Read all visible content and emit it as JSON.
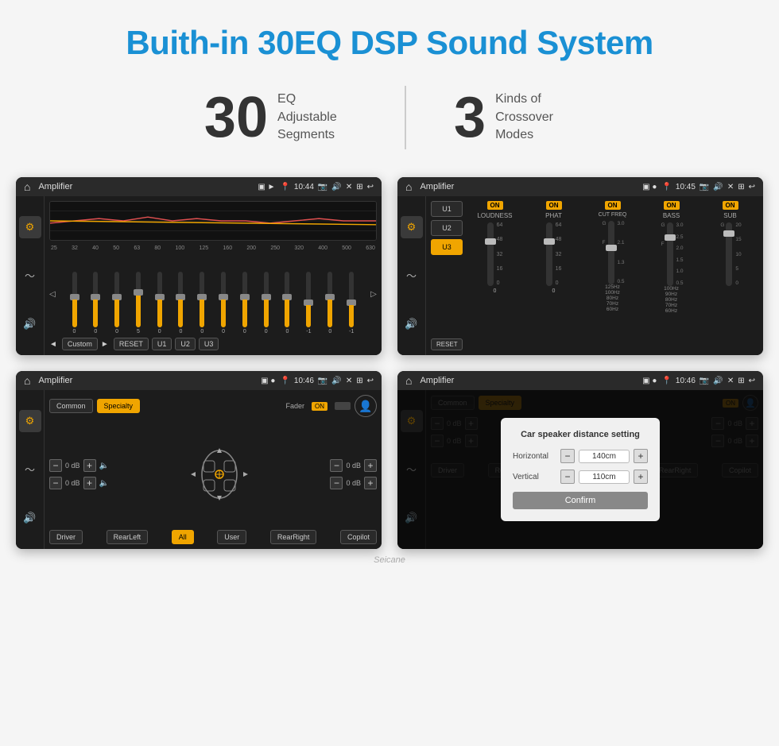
{
  "page": {
    "title": "Buith-in 30EQ DSP Sound System",
    "stats": [
      {
        "number": "30",
        "label": "EQ Adjustable\nSegments"
      },
      {
        "number": "3",
        "label": "Kinds of\nCrossover Modes"
      }
    ]
  },
  "screens": {
    "eq": {
      "status_bar": {
        "title": "Amplifier",
        "time": "10:44"
      },
      "freq_labels": [
        "25",
        "32",
        "40",
        "50",
        "63",
        "80",
        "100",
        "125",
        "160",
        "200",
        "250",
        "320",
        "400",
        "500",
        "630"
      ],
      "sliders": [
        {
          "pos": 55,
          "val": "0"
        },
        {
          "pos": 50,
          "val": "0"
        },
        {
          "pos": 45,
          "val": "0"
        },
        {
          "pos": 52,
          "val": "5"
        },
        {
          "pos": 48,
          "val": "0"
        },
        {
          "pos": 50,
          "val": "0"
        },
        {
          "pos": 50,
          "val": "0"
        },
        {
          "pos": 48,
          "val": "0"
        },
        {
          "pos": 50,
          "val": "0"
        },
        {
          "pos": 50,
          "val": "0"
        },
        {
          "pos": 50,
          "val": "0"
        },
        {
          "pos": 45,
          "val": "0"
        },
        {
          "pos": 42,
          "val": "-1"
        },
        {
          "pos": 50,
          "val": "0"
        },
        {
          "pos": 42,
          "val": "-1"
        }
      ],
      "buttons": {
        "prev": "◄",
        "label": "Custom",
        "play": "►",
        "reset": "RESET",
        "u1": "U1",
        "u2": "U2",
        "u3": "U3"
      }
    },
    "crossover": {
      "status_bar": {
        "title": "Amplifier",
        "time": "10:45"
      },
      "presets": [
        "U1",
        "U2",
        "U3"
      ],
      "active_preset": "U3",
      "channels": [
        {
          "name": "LOUDNESS",
          "on": true
        },
        {
          "name": "PHAT",
          "on": true
        },
        {
          "name": "CUT FREQ",
          "on": true
        },
        {
          "name": "BASS",
          "on": true
        },
        {
          "name": "SUB",
          "on": true
        }
      ],
      "reset_label": "RESET"
    },
    "specialty": {
      "status_bar": {
        "title": "Amplifier",
        "time": "10:46"
      },
      "tabs": [
        "Common",
        "Specialty"
      ],
      "active_tab": "Specialty",
      "fader_label": "Fader",
      "fader_on": "ON",
      "zones": {
        "front_left": "0 dB",
        "front_right": "0 dB",
        "rear_left": "0 dB",
        "rear_right": "0 dB"
      },
      "buttons": [
        "Driver",
        "RearLeft",
        "All",
        "User",
        "RearRight",
        "Copilot"
      ],
      "all_highlight": true
    },
    "distance": {
      "status_bar": {
        "title": "Amplifier",
        "time": "10:46"
      },
      "tabs": [
        "Common",
        "Specialty"
      ],
      "active_tab": "Specialty",
      "dialog": {
        "title": "Car speaker distance setting",
        "horizontal_label": "Horizontal",
        "horizontal_value": "140cm",
        "vertical_label": "Vertical",
        "vertical_value": "110cm",
        "confirm_label": "Confirm"
      }
    }
  },
  "watermark": "Seicane"
}
